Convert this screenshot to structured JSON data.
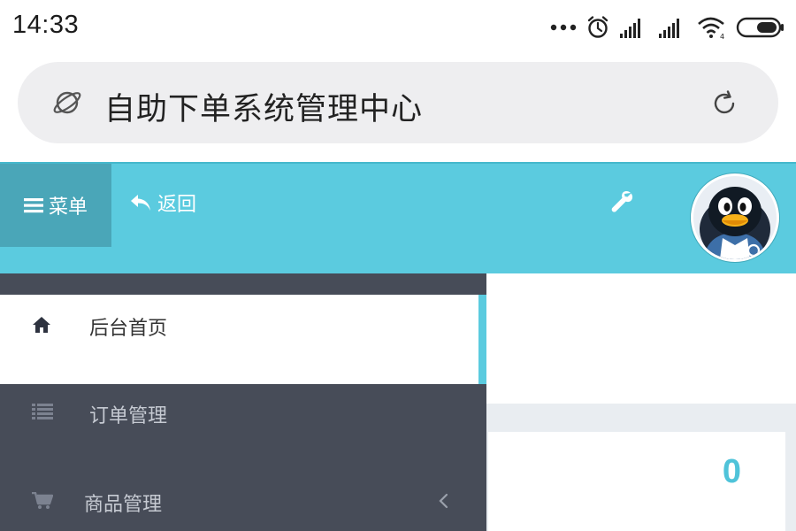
{
  "status_bar": {
    "time": "14:33",
    "icons": [
      "more-dots-icon",
      "alarm-icon",
      "signal-icon",
      "signal-icon",
      "wifi-icon",
      "battery-icon"
    ]
  },
  "browser": {
    "title": "自助下单系统管理中心",
    "icons": [
      "planet-icon",
      "refresh-icon"
    ]
  },
  "header": {
    "menu_label": "菜单",
    "back_label": "返回",
    "accent_color": "#5bcbdf",
    "icons": [
      "wrench-icon",
      "avatar-penguin"
    ]
  },
  "sidebar": {
    "items": [
      {
        "label": "后台首页",
        "icon": "home-icon",
        "active": true
      },
      {
        "label": "订单管理",
        "icon": "list-icon",
        "active": false
      },
      {
        "label": "商品管理",
        "icon": "cart-icon",
        "active": false,
        "has_submenu": true
      }
    ]
  },
  "dashboard": {
    "stat_value": "0",
    "stat_color": "#4fc3d9"
  }
}
